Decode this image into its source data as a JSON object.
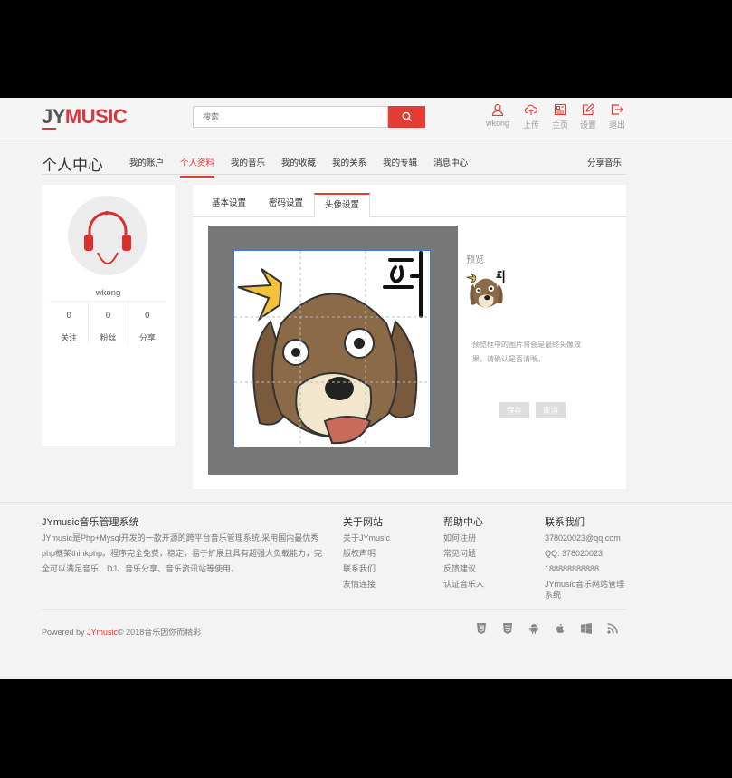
{
  "header": {
    "logo_j": "JY",
    "logo_m": "MUSIC",
    "search_placeholder": "搜索",
    "nav": [
      {
        "label": "wkong",
        "icon": "user-icon"
      },
      {
        "label": "上传",
        "icon": "upload-icon"
      },
      {
        "label": "主页",
        "icon": "home-icon"
      },
      {
        "label": "设置",
        "icon": "edit-icon"
      },
      {
        "label": "退出",
        "icon": "logout-icon"
      }
    ]
  },
  "subnav": {
    "title": "个人中心",
    "items": [
      "我的账户",
      "个人资料",
      "我的音乐",
      "我的收藏",
      "我的关系",
      "我的专辑",
      "消息中心"
    ],
    "active_index": 1,
    "share": "分享音乐"
  },
  "profile": {
    "username": "wkong",
    "stats": [
      {
        "value": "0",
        "label": "关注"
      },
      {
        "value": "0",
        "label": "粉丝"
      },
      {
        "value": "0",
        "label": "分享"
      }
    ]
  },
  "panel": {
    "tabs": [
      "基本设置",
      "密码设置",
      "头像设置"
    ],
    "active_tab": 2,
    "preview_label": "预览",
    "preview_tip": "预览框中的图片将会是最终头像效果，请确认是否清晰。",
    "save_label": "保存",
    "cancel_label": "取消"
  },
  "footer": {
    "about_title": "JYmusic音乐管理系统",
    "about_text": "JYmusic是Php+Mysql开发的一款开源的跨平台音乐管理系统,采用国内最优秀php框架thinkphp。程序完全免费，稳定，易于扩展且具有超强大负载能力，完全可以满足音乐、DJ、音乐分享、音乐资讯站等使用。",
    "site_title": "关于网站",
    "site_links": [
      "关于JYmusic",
      "版权声明",
      "联系我们",
      "友情连接"
    ],
    "help_title": "帮助中心",
    "help_links": [
      "如何注册",
      "常见问题",
      "反馈建议",
      "认证音乐人"
    ],
    "contact_title": "联系我们",
    "contact_lines": [
      "378020023@qq.com",
      "QQ: 378020023",
      "188888888888",
      "JYmusic音乐网站管理系统"
    ],
    "copyright_prefix": "Powered by ",
    "copyright_brand": "JYmusic",
    "copyright_suffix": "© 2018音乐因你而精彩",
    "icons": [
      "html5-icon",
      "css3-icon",
      "android-icon",
      "apple-icon",
      "windows-icon",
      "rss-icon"
    ]
  },
  "colors": {
    "accent": "#e23c33",
    "background": "#f3f3f3"
  }
}
